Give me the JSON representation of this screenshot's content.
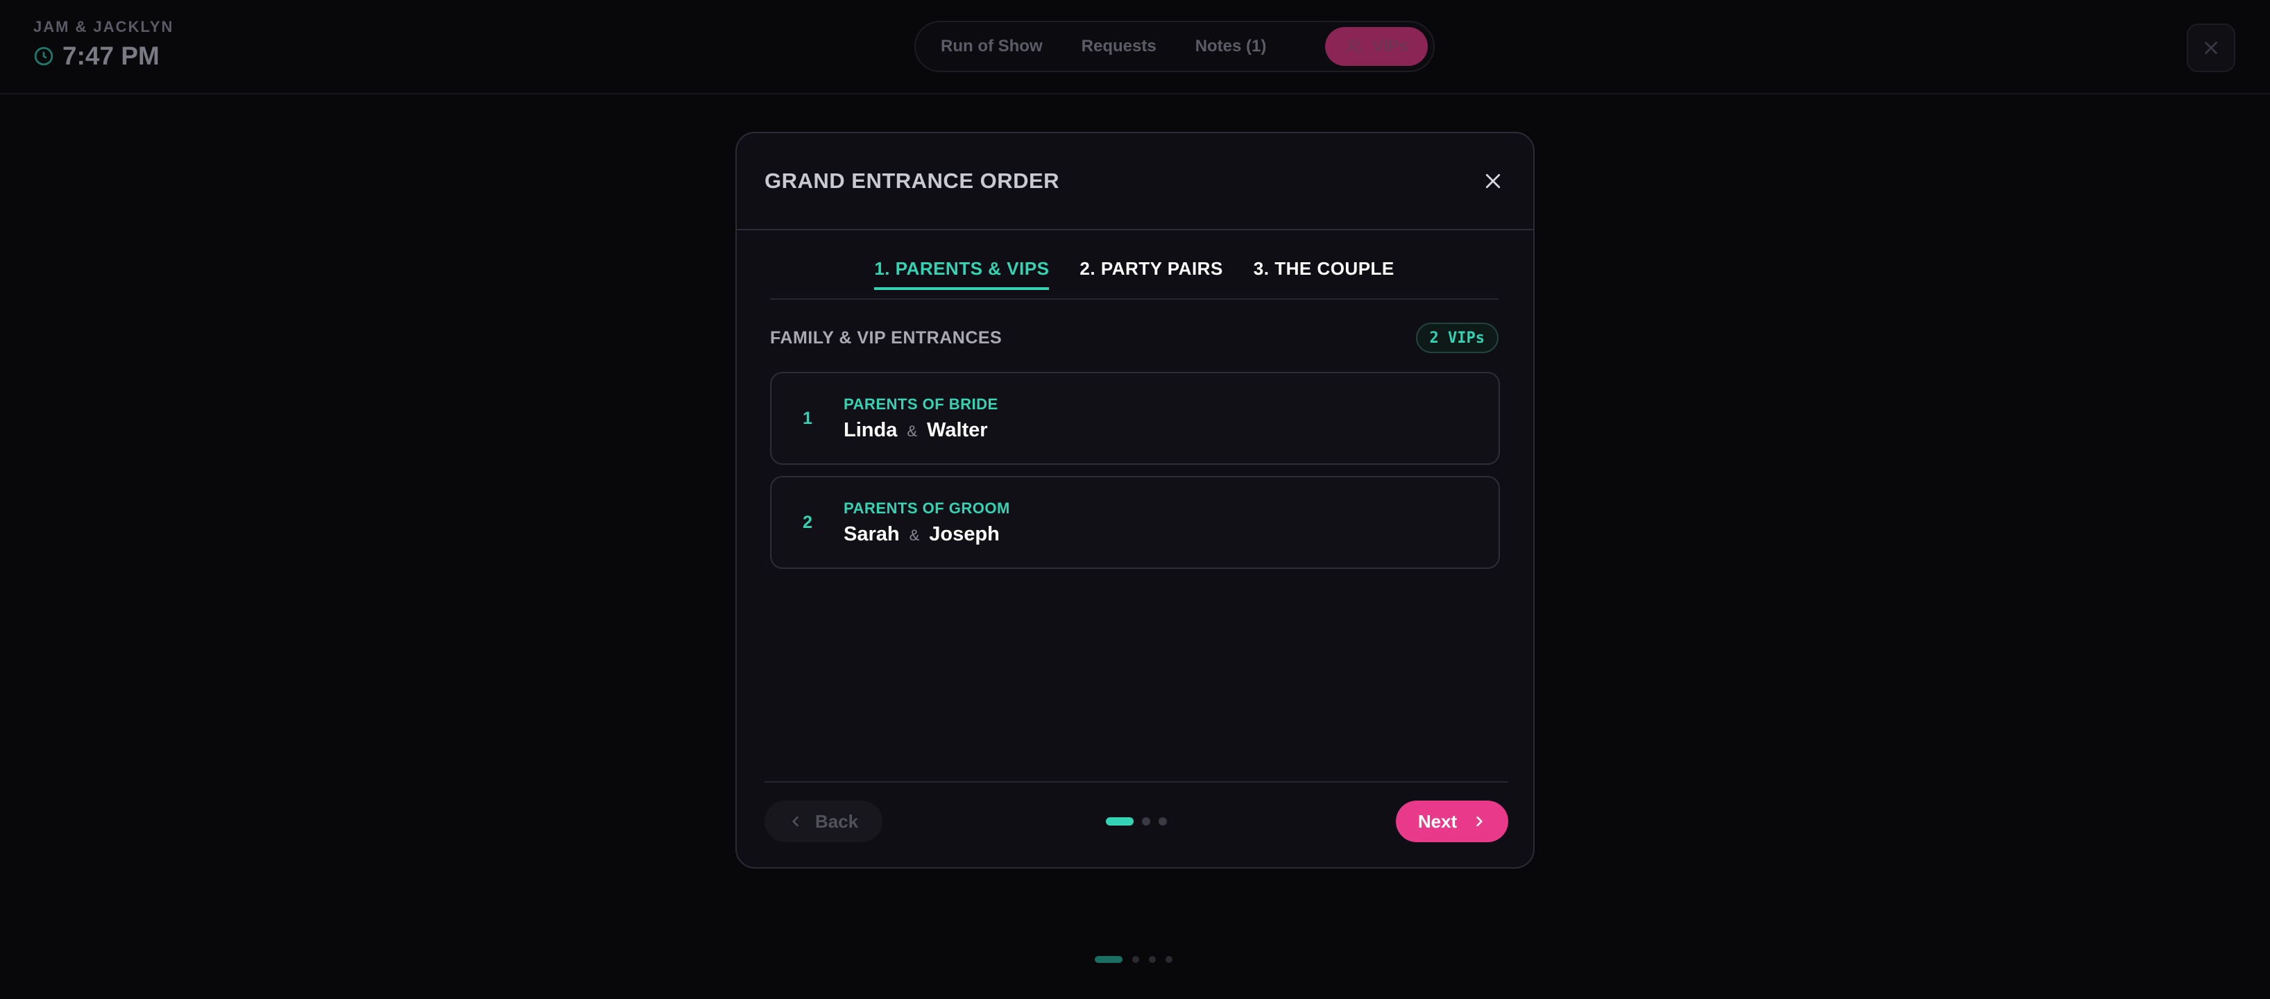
{
  "header": {
    "event_name": "JAM & JACKLYN",
    "time": "7:47 PM",
    "nav": [
      "Run of Show",
      "Requests",
      "Notes (1)"
    ],
    "vip_label": "VIPs"
  },
  "modal": {
    "title": "GRAND ENTRANCE ORDER",
    "tabs": [
      "1. PARENTS & VIPS",
      "2. PARTY PAIRS",
      "3. THE COUPLE"
    ],
    "active_tab": 0,
    "section_title": "FAMILY & VIP ENTRANCES",
    "badge": "2 VIPs",
    "entries": [
      {
        "number": "1",
        "role": "PARENTS OF BRIDE",
        "name_a": "Linda",
        "amp": "&",
        "name_b": "Walter"
      },
      {
        "number": "2",
        "role": "PARENTS OF GROOM",
        "name_a": "Sarah",
        "amp": "&",
        "name_b": "Joseph"
      }
    ],
    "back_label": "Back",
    "next_label": "Next",
    "step_total": 3,
    "step_current": 1
  },
  "colors": {
    "accent_teal": "#34d3b3",
    "accent_pink": "#e8398a",
    "background": "#08080b"
  },
  "icons": {
    "clock": "clock-icon",
    "vip": "users-icon",
    "close": "close-icon",
    "back": "chevron-left-icon",
    "next": "chevron-right-icon"
  }
}
